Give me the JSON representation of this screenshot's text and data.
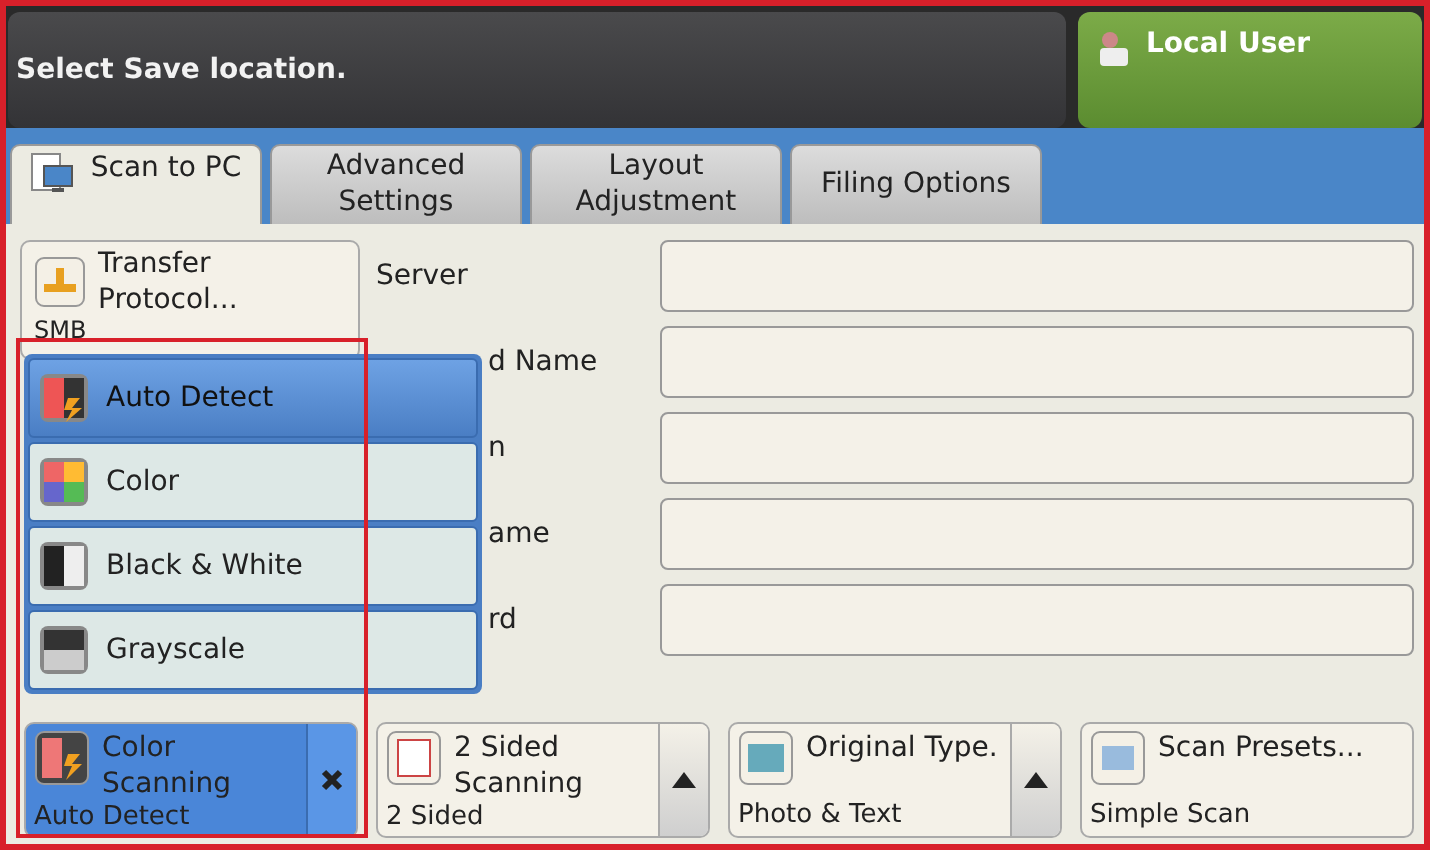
{
  "header": {
    "message": "Select Save location.",
    "user": "Local User"
  },
  "tabs": [
    {
      "label": "Scan to PC",
      "selected": true
    },
    {
      "label": "Advanced Settings",
      "selected": false
    },
    {
      "label": "Layout Adjustment",
      "selected": false
    },
    {
      "label": "Filing Options",
      "selected": false
    }
  ],
  "transfer_button": {
    "label": "Transfer Protocol...",
    "value": "SMB"
  },
  "fields": [
    {
      "label": "Server"
    },
    {
      "label": "d Name"
    },
    {
      "label": "n"
    },
    {
      "label": "ame"
    },
    {
      "label": "rd"
    }
  ],
  "color_menu": [
    {
      "label": "Auto Detect",
      "selected": true
    },
    {
      "label": "Color",
      "selected": false
    },
    {
      "label": "Black & White",
      "selected": false
    },
    {
      "label": "Grayscale",
      "selected": false
    }
  ],
  "feature_buttons": [
    {
      "kind": "active",
      "label": "Color Scanning",
      "value": "Auto Detect"
    },
    {
      "kind": "arrow",
      "label": "2 Sided Scanning",
      "value": "2 Sided"
    },
    {
      "kind": "arrow",
      "label": "Original Type.",
      "value": "Photo & Text"
    },
    {
      "kind": "plain",
      "label": "Scan Presets...",
      "value": "Simple Scan"
    }
  ]
}
